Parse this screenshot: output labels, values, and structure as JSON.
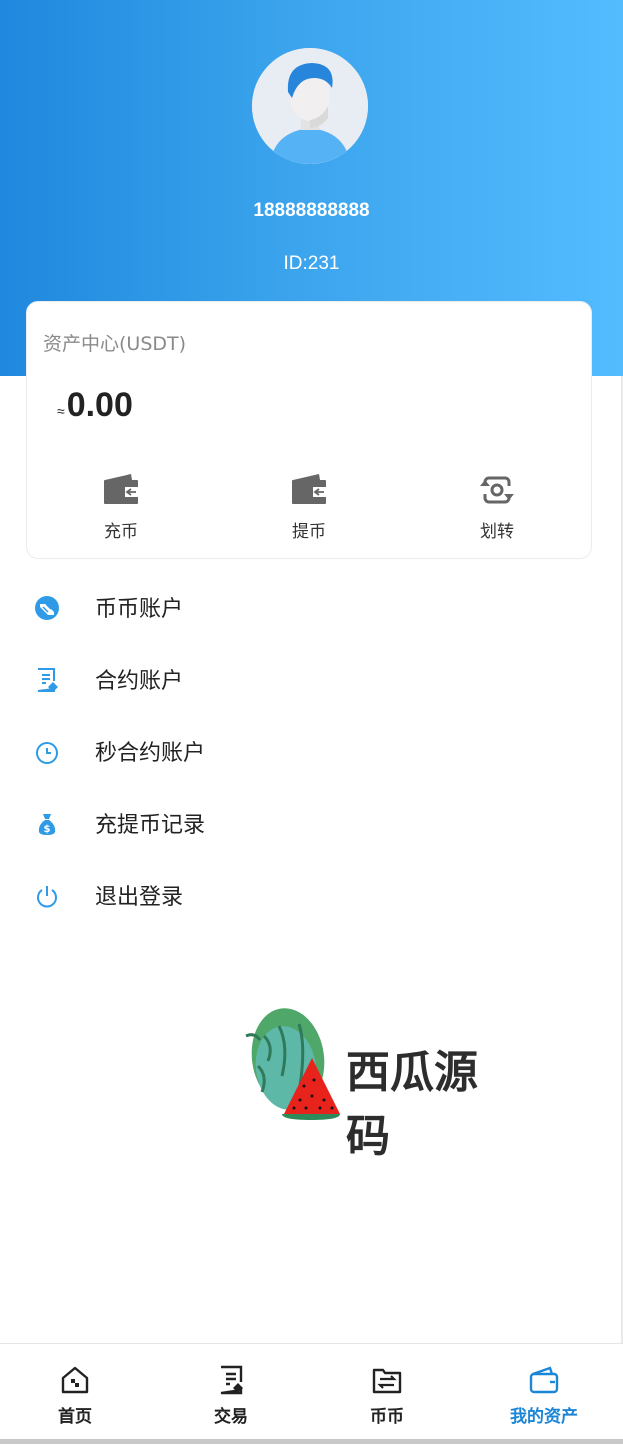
{
  "profile": {
    "phone": "18888888888",
    "id_text": "ID:231"
  },
  "asset_card": {
    "title": "资产中心(USDT)",
    "approx_symbol": "≈",
    "balance": "0.00",
    "actions": [
      {
        "label": "充币",
        "icon": "wallet-icon"
      },
      {
        "label": "提币",
        "icon": "wallet-icon"
      },
      {
        "label": "划转",
        "icon": "transfer-icon"
      }
    ]
  },
  "menu": {
    "items": [
      {
        "label": "币币账户",
        "icon": "coin-account-icon"
      },
      {
        "label": "合约账户",
        "icon": "contract-icon"
      },
      {
        "label": "秒合约账户",
        "icon": "clock-icon"
      },
      {
        "label": "充提币记录",
        "icon": "money-bag-icon"
      },
      {
        "label": "退出登录",
        "icon": "power-icon"
      }
    ]
  },
  "watermark": {
    "text": "西瓜源码"
  },
  "tabbar": {
    "tabs": [
      {
        "label": "首页",
        "icon": "home-icon"
      },
      {
        "label": "交易",
        "icon": "document-icon"
      },
      {
        "label": "币币",
        "icon": "folder-exchange-icon"
      },
      {
        "label": "我的资产",
        "icon": "wallet-icon",
        "active": true
      }
    ]
  },
  "colors": {
    "header_gradient_start": "#2088de",
    "header_gradient_end": "#53bcff",
    "accent": "#1c86d6",
    "menu_icon": "#2f9be6"
  }
}
